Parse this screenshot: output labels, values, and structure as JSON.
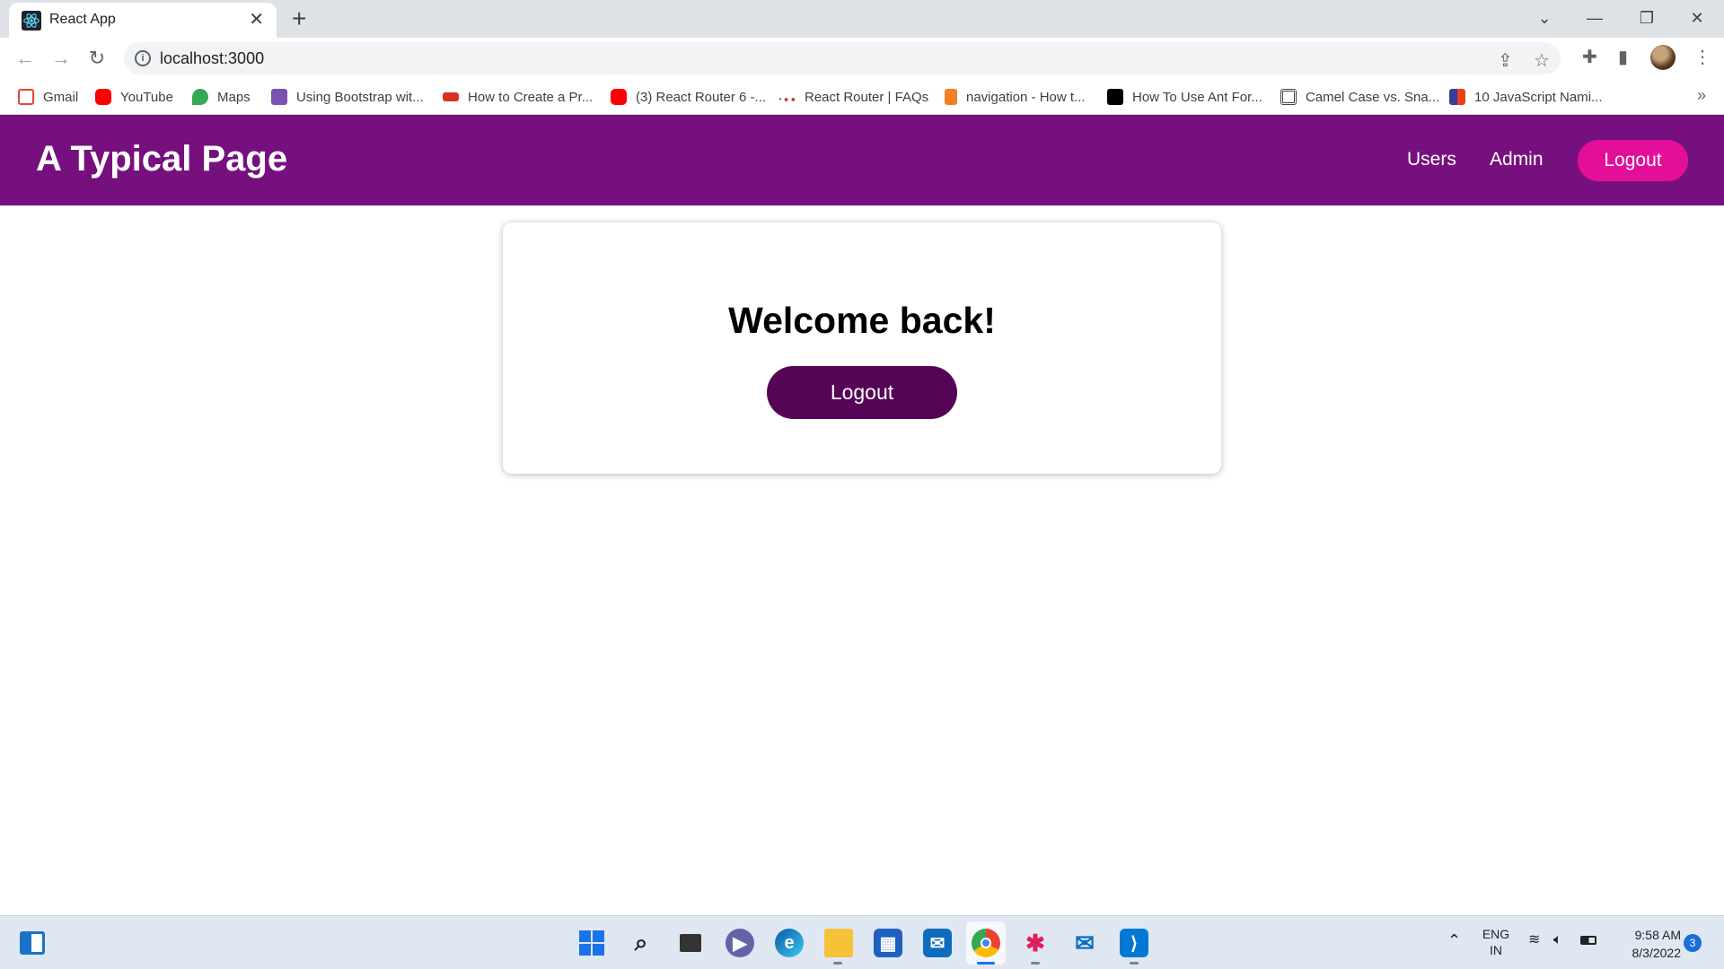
{
  "browser": {
    "tab_title": "React App",
    "url": "localhost:3000",
    "bookmarks": [
      {
        "label": "Gmail",
        "icon": "gmail-icon",
        "color": "#ea4335"
      },
      {
        "label": "YouTube",
        "icon": "youtube-icon",
        "color": "#ff0000"
      },
      {
        "label": "Maps",
        "icon": "maps-icon",
        "color": "#34a853"
      },
      {
        "label": "Using Bootstrap wit...",
        "icon": "bootstrap-icon",
        "color": "#7952b3"
      },
      {
        "label": "How to Create a Pr...",
        "icon": "site-icon",
        "color": "#d93025"
      },
      {
        "label": "(3) React Router 6 -...",
        "icon": "youtube-icon",
        "color": "#ff0000"
      },
      {
        "label": "React Router | FAQs",
        "icon": "react-router-icon",
        "color": "#ca4245"
      },
      {
        "label": "navigation - How t...",
        "icon": "stackoverflow-icon",
        "color": "#f48024"
      },
      {
        "label": "How To Use Ant For...",
        "icon": "medium-icon",
        "color": "#000000"
      },
      {
        "label": "Camel Case vs. Sna...",
        "icon": "site-icon",
        "color": "#444444"
      },
      {
        "label": "10 JavaScript Nami...",
        "icon": "site-icon",
        "color": "#3b3b98"
      }
    ]
  },
  "app": {
    "title": "A Typical Page",
    "nav": {
      "users": "Users",
      "admin": "Admin",
      "logout": "Logout"
    },
    "card": {
      "heading": "Welcome back!",
      "logout": "Logout"
    }
  },
  "taskbar": {
    "language": "ENG",
    "region": "IN",
    "time": "9:58 AM",
    "date": "8/3/2022",
    "notifications": "3"
  },
  "colors": {
    "header": "#77107f",
    "nav_logout": "#e30f99",
    "card_logout": "#560556"
  }
}
